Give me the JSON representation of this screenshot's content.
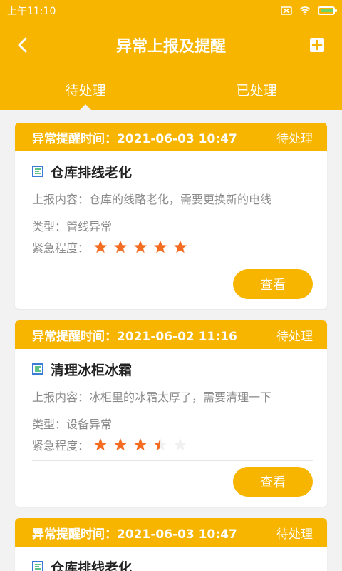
{
  "status_bar": {
    "time": "上午11:10",
    "icons": [
      "sim-off-icon",
      "wifi-icon",
      "battery-charging-icon"
    ]
  },
  "header": {
    "title": "异常上报及提醒",
    "back_icon": "back-icon",
    "add_icon": "add-icon"
  },
  "tabs": [
    {
      "label": "待处理",
      "active": true
    },
    {
      "label": "已处理",
      "active": false
    }
  ],
  "labels": {
    "reminder_prefix": "异常提醒时间：",
    "report_prefix": "上报内容：",
    "type_prefix": "类型：",
    "urgency_prefix": "紧急程度：",
    "view_button": "查看"
  },
  "cards": [
    {
      "time": "2021-06-03 10:47",
      "status": "待处理",
      "title": "仓库排线老化",
      "content": "仓库的线路老化，需要更换新的电线",
      "type": "管线异常",
      "urgency": 5,
      "button": "查看"
    },
    {
      "time": "2021-06-02 11:16",
      "status": "待处理",
      "title": "清理冰柜冰霜",
      "content": "冰柜里的冰霜太厚了，需要清理一下",
      "type": "设备异常",
      "urgency": 3.5,
      "button": "查看"
    },
    {
      "time": "2021-06-03 10:47",
      "status": "待处理",
      "title": "仓库排线老化"
    }
  ],
  "colors": {
    "accent": "#f7b500",
    "star_filled": "#f36c21",
    "star_empty": "#f1f1f1",
    "doc_icon": "#3a7bd5"
  }
}
